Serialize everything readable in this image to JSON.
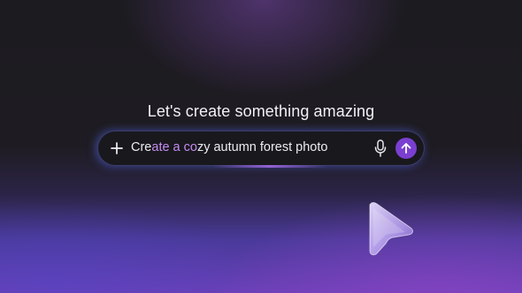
{
  "heading": "Let's create something amazing",
  "prompt": {
    "text_plain_start": "Cre",
    "text_highlight": "ate a co",
    "text_plain_end": "zy autumn forest photo"
  },
  "icons": {
    "add": "plus-icon",
    "mic": "microphone-icon",
    "send": "arrow-up-icon",
    "cursor": "pointer-cursor-icon"
  },
  "colors": {
    "accent": "#7a3fd0",
    "highlight_text": "#c38cf0",
    "glow": "#5a6eff"
  }
}
